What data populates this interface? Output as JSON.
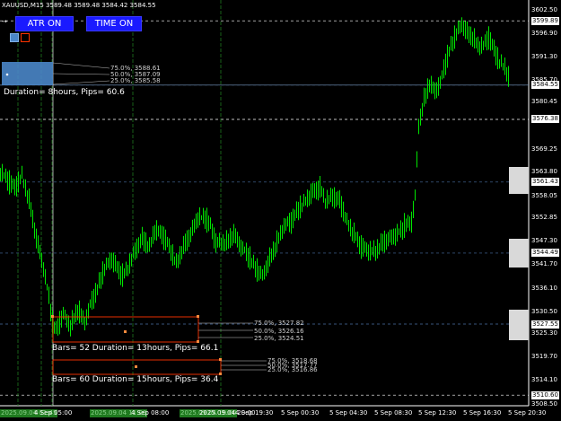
{
  "header": {
    "symbol_line": "XAUUSD,M15  3589.48 3589.48 3584.42 3584.55"
  },
  "buttons": {
    "atr": "ATR ON",
    "time": "TIME ON"
  },
  "colors": {
    "background": "#000000",
    "candles": "#00e600",
    "grid_dashed": "#4a6fa5",
    "vline": "#1f5f1f",
    "orange_box": "#ff3300",
    "blue_box": "#4a86c8",
    "button": "#1a1aff"
  },
  "price_axis": {
    "labels": [
      "3602.50",
      "3599.89",
      "3596.90",
      "3591.30",
      "3585.70",
      "3580.45",
      "3576.38",
      "3569.25",
      "3563.80",
      "3561.43",
      "3558.05",
      "3552.85",
      "3547.30",
      "3544.49",
      "3541.70",
      "3536.10",
      "3530.50",
      "3527.55",
      "3525.30",
      "3519.70",
      "3514.10",
      "3510.60",
      "3508.50"
    ],
    "current_price": "3584.55"
  },
  "time_axis": {
    "labels": [
      "2025.09.04 01:45",
      "2025.09.04 11:00",
      "2025.09.04 19:00",
      "2025.09.04 20:00",
      "4 Sep 05:00",
      "4 Sep 08:00",
      "4 Sep 19:30",
      "5 Sep 00:30",
      "5 Sep 04:30",
      "5 Sep 08:30",
      "5 Sep 12:30",
      "5 Sep 16:30",
      "5 Sep 20:30"
    ]
  },
  "atr_top": {
    "fib75": "75.0%, 3588.61",
    "fib50": "50.0%, 3587.09",
    "fib25": "25.0%, 3585.58",
    "info": "Duration= 8hours,  Pips= 60.6"
  },
  "box_mid": {
    "fib75": "75.0%, 3527.82",
    "fib50": "50.0%, 3526.16",
    "fib25": "25.0%, 3524.51",
    "info": "Bars= 52 Duration= 13hours,  Pips= 66.1"
  },
  "box_low": {
    "fib75": "75.0%, 3518.68",
    "fib50": "50.0%, 3517.77",
    "fib25": "25.0%, 3516.86",
    "info": "Bars= 60 Duration= 15hours,  Pips= 36.4"
  }
}
